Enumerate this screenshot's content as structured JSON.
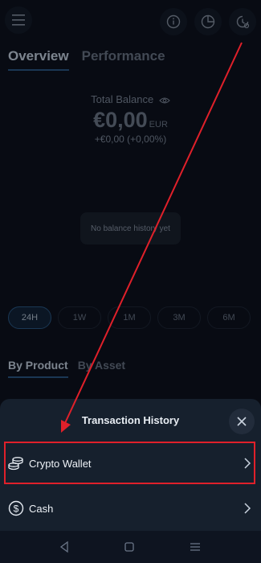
{
  "tabs": [
    {
      "label": "Overview",
      "active": true
    },
    {
      "label": "Performance",
      "active": false
    }
  ],
  "balance": {
    "label": "Total Balance",
    "value": "€0,00",
    "currency": "EUR",
    "change": "+€0,00 (+0,00%)"
  },
  "chart": {
    "empty_message": "No balance history yet"
  },
  "ranges": [
    {
      "label": "24H",
      "active": true
    },
    {
      "label": "1W",
      "active": false
    },
    {
      "label": "1M",
      "active": false
    },
    {
      "label": "3M",
      "active": false
    },
    {
      "label": "6M",
      "active": false
    }
  ],
  "breakdown_tabs": [
    {
      "label": "By Product",
      "active": true
    },
    {
      "label": "By Asset",
      "active": false
    }
  ],
  "sheet": {
    "title": "Transaction History",
    "items": [
      {
        "label": "Crypto Wallet",
        "icon": "coins-icon"
      },
      {
        "label": "Cash",
        "icon": "dollar-circle-icon"
      }
    ]
  },
  "icons": [
    "menu-icon",
    "info-icon",
    "pie-chart-icon",
    "clock-history-icon",
    "close-icon",
    "chevron-right-icon",
    "back-nav-icon",
    "home-nav-icon",
    "recents-nav-icon"
  ],
  "colors": {
    "accent": "#2b5a88",
    "highlight": "#e0202a",
    "background": "#0d1320"
  }
}
